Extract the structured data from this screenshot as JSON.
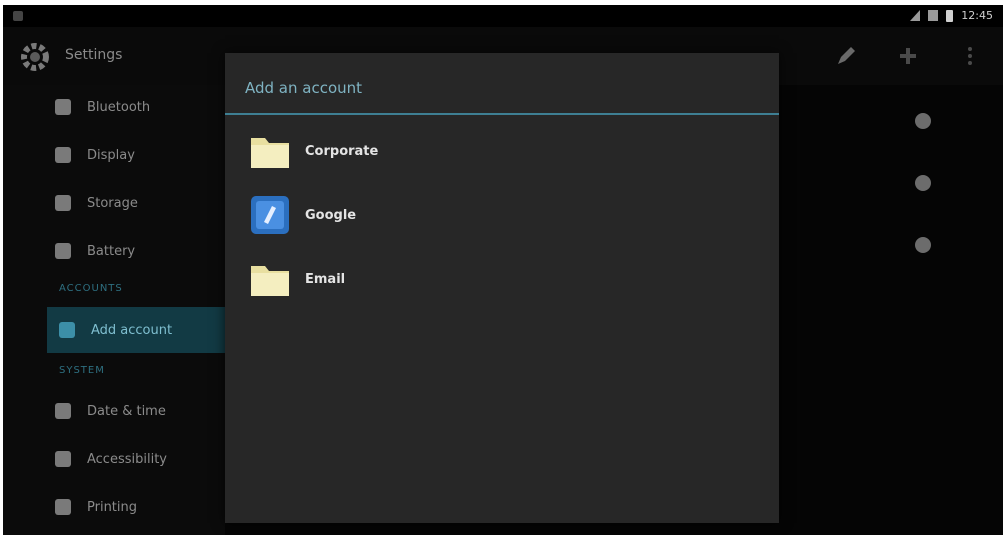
{
  "app": {
    "title": "Settings"
  },
  "status_bar": {
    "time": "12:45"
  },
  "sidebar": {
    "items": [
      {
        "label": "Bluetooth",
        "icon": "bluetooth-icon"
      },
      {
        "label": "Display",
        "icon": "display-icon"
      },
      {
        "label": "Storage",
        "icon": "storage-icon"
      },
      {
        "label": "Battery",
        "icon": "battery-icon"
      }
    ],
    "section_accounts": "ACCOUNTS",
    "active_item": {
      "label": "Add account",
      "icon": "add-icon"
    },
    "section_system": "SYSTEM",
    "system_items": [
      {
        "label": "Date & time",
        "icon": "clock-icon"
      },
      {
        "label": "Accessibility",
        "icon": "accessibility-icon"
      },
      {
        "label": "Printing",
        "icon": "print-icon"
      }
    ]
  },
  "dialog": {
    "title": "Add an account",
    "options": [
      {
        "label": "Corporate",
        "icon": "corporate-folder-icon"
      },
      {
        "label": "Google",
        "icon": "google-icon"
      },
      {
        "label": "Email",
        "icon": "email-folder-icon"
      }
    ]
  },
  "colors": {
    "accent": "#3e7f93",
    "active_bg": "#123a44",
    "dialog_bg": "#272727"
  }
}
